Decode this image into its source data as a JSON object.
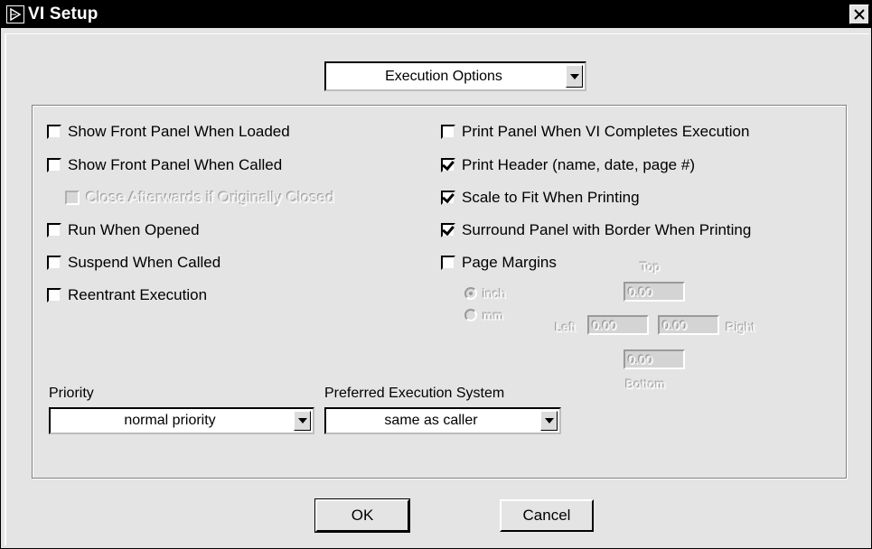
{
  "window": {
    "title": "VI Setup"
  },
  "section_dropdown": {
    "value": "Execution Options"
  },
  "left_options": [
    {
      "label": "Show Front Panel When Loaded",
      "checked": false,
      "disabled": false
    },
    {
      "label": "Show Front Panel When Called",
      "checked": false,
      "disabled": false
    },
    {
      "label": "Close Afterwards if Originally Closed",
      "checked": false,
      "disabled": true
    },
    {
      "label": "Run When Opened",
      "checked": false,
      "disabled": false
    },
    {
      "label": "Suspend When Called",
      "checked": false,
      "disabled": false
    },
    {
      "label": "Reentrant Execution",
      "checked": false,
      "disabled": false
    }
  ],
  "right_options": [
    {
      "label": "Print Panel When VI Completes Execution",
      "checked": false
    },
    {
      "label": "Print Header (name, date, page #)",
      "checked": true
    },
    {
      "label": "Scale to Fit When Printing",
      "checked": true
    },
    {
      "label": "Surround Panel with Border When Printing",
      "checked": true
    },
    {
      "label": "Page Margins",
      "checked": false
    }
  ],
  "page_margins": {
    "units": [
      {
        "label": "inch",
        "selected": true
      },
      {
        "label": "mm",
        "selected": false
      }
    ],
    "top_label": "Top",
    "bottom_label": "Bottom",
    "left_label": "Left",
    "right_label": "Right",
    "top": "0.00",
    "bottom": "0.00",
    "left": "0.00",
    "right": "0.00"
  },
  "priority": {
    "label": "Priority",
    "value": "normal priority"
  },
  "execution_system": {
    "label": "Preferred Execution System",
    "value": "same as caller"
  },
  "buttons": {
    "ok": "OK",
    "cancel": "Cancel"
  }
}
